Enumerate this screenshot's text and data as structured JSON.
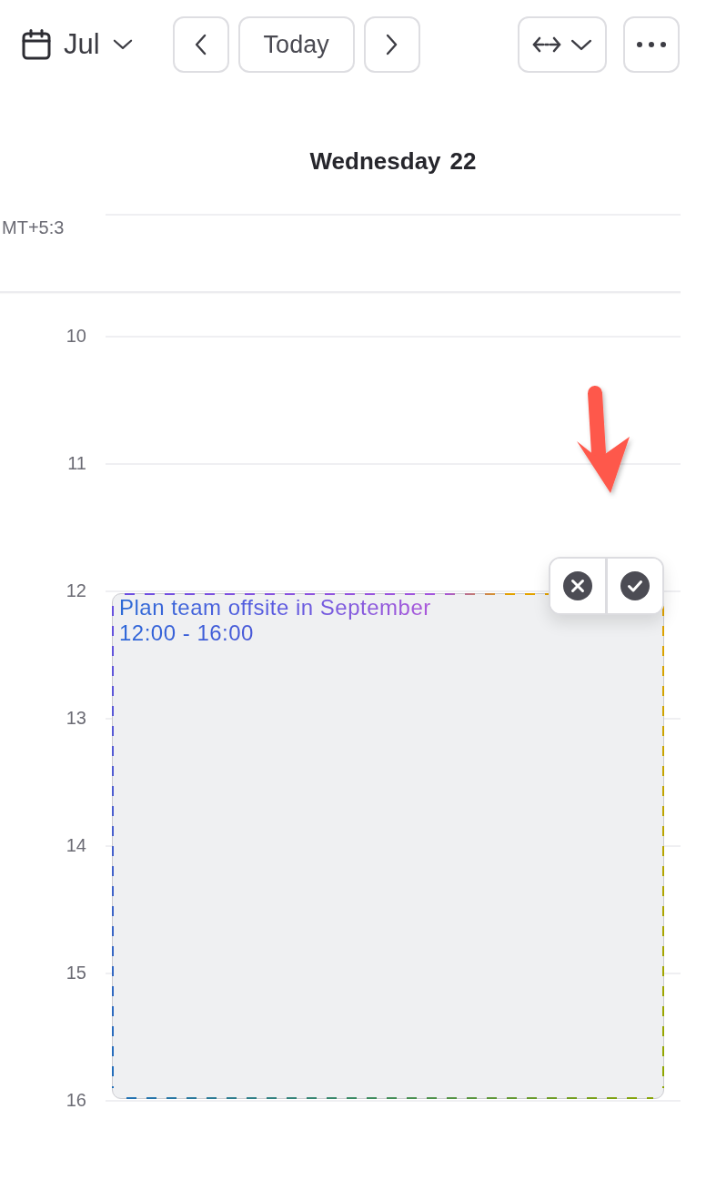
{
  "toolbar": {
    "month": "Jul",
    "today": "Today"
  },
  "day_header": {
    "weekday": "Wednesday",
    "day": "22"
  },
  "timezone": "MT+5:3",
  "hours": [
    "10",
    "11",
    "12",
    "13",
    "14",
    "15",
    "16"
  ],
  "event": {
    "title": "Plan team offsite in September",
    "time": "12:00 - 16:00"
  }
}
